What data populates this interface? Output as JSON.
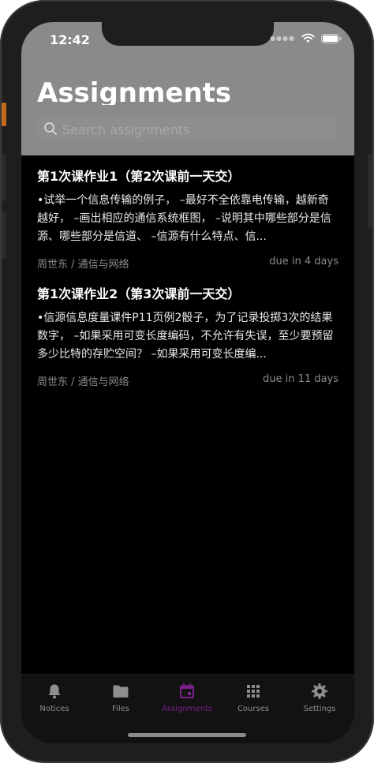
{
  "status_bar": {
    "time": "12:42"
  },
  "header": {
    "title": "Assignments",
    "search_placeholder": "Search assignments"
  },
  "assignments": [
    {
      "title": "第1次课作业1（第2次课前一天交）",
      "description": "•试举一个信息传输的例子， –最好不全依靠电传输，越新奇越好， –画出相应的通信系统框图， –说明其中哪些部分是信源、哪些部分是信道、 –信源有什么特点、信...",
      "course": "周世东 / 通信与网络",
      "due": "due in 4 days"
    },
    {
      "title": "第1次课作业2（第3次课前一天交）",
      "description": "•信源信息度量课件P11页例2骰子，为了记录投掷3次的结果数字， –如果采用可变长度编码，不允许有失误，至少要预留多少比特的存贮空间？ –如果采用可变长度编...",
      "course": "周世东 / 通信与网络",
      "due": "due in 11 days"
    }
  ],
  "tabbar": {
    "tabs": [
      {
        "label": "Notices",
        "icon": "bell-icon"
      },
      {
        "label": "Files",
        "icon": "folder-icon"
      },
      {
        "label": "Assignments",
        "icon": "calendar-icon",
        "active": true
      },
      {
        "label": "Courses",
        "icon": "grid-icon"
      },
      {
        "label": "Settings",
        "icon": "gear-icon"
      }
    ]
  },
  "colors": {
    "accent": "#7a1f8c",
    "header_bg": "#8a8a8a",
    "background": "#000000"
  }
}
